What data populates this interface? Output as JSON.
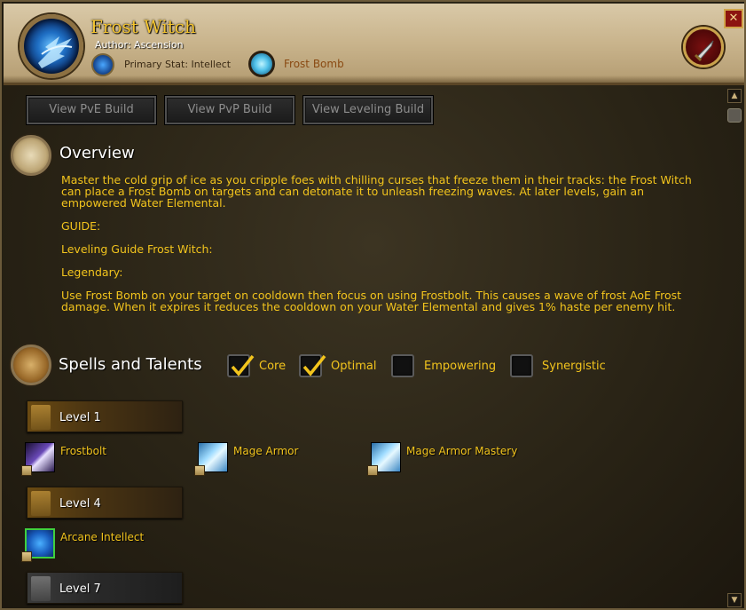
{
  "header": {
    "title": "Frost Witch",
    "author": "Author: Ascension",
    "primary_stat": "Primary Stat: Intellect",
    "signature_spell": "Frost Bomb",
    "close_label": "✕"
  },
  "build_buttons": [
    "View PvE Build",
    "View PvP Build",
    "View Leveling Build"
  ],
  "overview": {
    "title": "Overview",
    "description": "Master the cold grip of ice as you cripple foes with chilling curses that freeze them in their tracks: the Frost Witch can place a Frost Bomb on targets and can detonate it to unleash freezing waves. At later levels, gain an empowered Water Elemental.",
    "guide": "GUIDE:",
    "leveling_guide": "Leveling Guide Frost Witch:",
    "legendary": "Legendary:",
    "legendary_text": "Use Frost Bomb on your target on cooldown then focus on using Frostbolt. This causes a wave of frost AoE Frost damage. When it expires it reduces the cooldown on your Water Elemental and gives 1% haste per enemy hit."
  },
  "spells": {
    "title": "Spells and Talents",
    "filters": [
      {
        "label": "Core",
        "checked": true
      },
      {
        "label": "Optimal",
        "checked": true
      },
      {
        "label": "Empowering",
        "checked": false
      },
      {
        "label": "Synergistic",
        "checked": false
      }
    ],
    "levels": [
      {
        "label": "Level 1",
        "spells": [
          "Frostbolt",
          "Mage Armor",
          "Mage Armor Mastery"
        ]
      },
      {
        "label": "Level 4",
        "spells": [
          "Arcane Intellect"
        ]
      },
      {
        "label": "Level 7",
        "spells": []
      }
    ]
  },
  "scrollbar": {
    "up": "▲",
    "down": "▼"
  },
  "colors": {
    "gold_text": "#f2c41d",
    "title_gold": "#f4c531",
    "header_parchment": "#c9b48c"
  }
}
